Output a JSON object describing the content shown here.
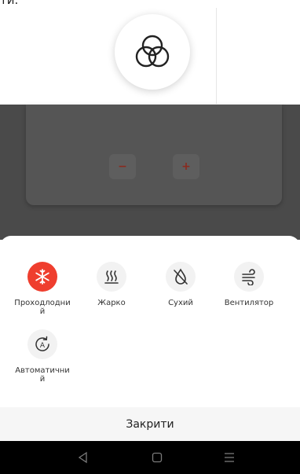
{
  "top": {
    "partial_text": "ти."
  },
  "controls": {
    "minus_label": "−",
    "plus_label": "+"
  },
  "modes": [
    {
      "label": "Проходлодний",
      "icon": "snowflake-icon",
      "active": true
    },
    {
      "label": "Жарко",
      "icon": "heat-icon",
      "active": false
    },
    {
      "label": "Сухий",
      "icon": "dry-icon",
      "active": false
    },
    {
      "label": "Вентилятор",
      "icon": "fan-icon",
      "active": false
    },
    {
      "label": "Автоматичний",
      "icon": "auto-icon",
      "active": false
    }
  ],
  "sheet": {
    "close_label": "Закрити"
  },
  "colors": {
    "accent": "#ef3e2e",
    "overlay": "#4a4a4a",
    "sheet": "#ffffff",
    "navbar": "#000000"
  },
  "navigation": {
    "icons": [
      "back-icon",
      "home-icon",
      "menu-icon"
    ]
  }
}
